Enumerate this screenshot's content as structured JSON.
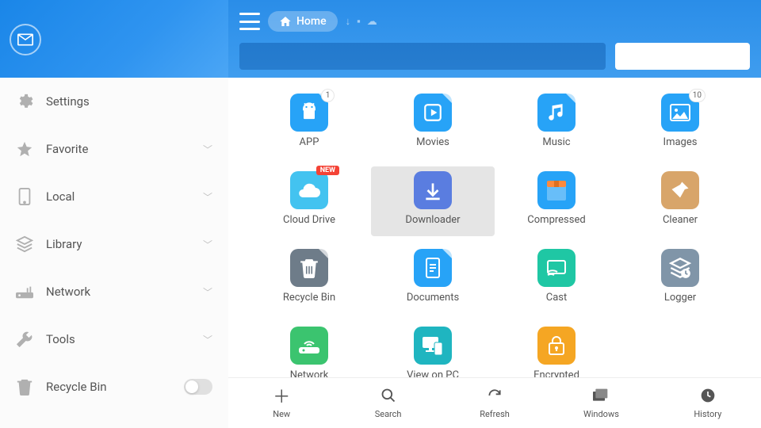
{
  "colors": {
    "primary": "#2e90ea",
    "accent": "#27a3f7"
  },
  "header": {
    "breadcrumb": "Home"
  },
  "sidebar": {
    "items": [
      {
        "label": "Settings",
        "icon": "gear",
        "expandable": false
      },
      {
        "label": "Favorite",
        "icon": "star",
        "expandable": true
      },
      {
        "label": "Local",
        "icon": "phone",
        "expandable": true
      },
      {
        "label": "Library",
        "icon": "stack",
        "expandable": true
      },
      {
        "label": "Network",
        "icon": "router",
        "expandable": true
      },
      {
        "label": "Tools",
        "icon": "wrench",
        "expandable": true
      },
      {
        "label": "Recycle Bin",
        "icon": "trash",
        "toggle": true
      }
    ]
  },
  "grid": {
    "tiles": [
      {
        "label": "APP",
        "icon": "android",
        "color": "#27a3f7",
        "badge": "1",
        "fold": true
      },
      {
        "label": "Movies",
        "icon": "play",
        "color": "#27a3f7",
        "fold": true
      },
      {
        "label": "Music",
        "icon": "note",
        "color": "#27a3f7",
        "fold": true
      },
      {
        "label": "Images",
        "icon": "image",
        "color": "#27a3f7",
        "badge": "10",
        "fold": true
      },
      {
        "label": "Cloud Drive",
        "icon": "cloud",
        "color": "#43c3f0",
        "flag": "NEW"
      },
      {
        "label": "Downloader",
        "icon": "download",
        "color": "#5a7de0",
        "selected": true
      },
      {
        "label": "Compressed",
        "icon": "zip",
        "color": "#27a3f7",
        "ziptop": "#ff8a3c"
      },
      {
        "label": "Cleaner",
        "icon": "broom",
        "color": "#d8a56a"
      },
      {
        "label": "Recycle Bin",
        "icon": "trash-white",
        "color": "#6e7c89",
        "fold": true
      },
      {
        "label": "Documents",
        "icon": "doc",
        "color": "#27a3f7",
        "fold": true
      },
      {
        "label": "Cast",
        "icon": "cast",
        "color": "#1fc7a4"
      },
      {
        "label": "Logger",
        "icon": "log",
        "color": "#8095a8"
      },
      {
        "label": "Network",
        "icon": "router2",
        "color": "#3bc46f"
      },
      {
        "label": "View on PC",
        "icon": "pc",
        "color": "#1fb5c0"
      },
      {
        "label": "Encrypted",
        "icon": "lock",
        "color": "#f5a623"
      }
    ]
  },
  "bottombar": {
    "items": [
      {
        "label": "New",
        "icon": "plus"
      },
      {
        "label": "Search",
        "icon": "search"
      },
      {
        "label": "Refresh",
        "icon": "refresh"
      },
      {
        "label": "Windows",
        "icon": "windows"
      },
      {
        "label": "History",
        "icon": "clock"
      }
    ]
  }
}
